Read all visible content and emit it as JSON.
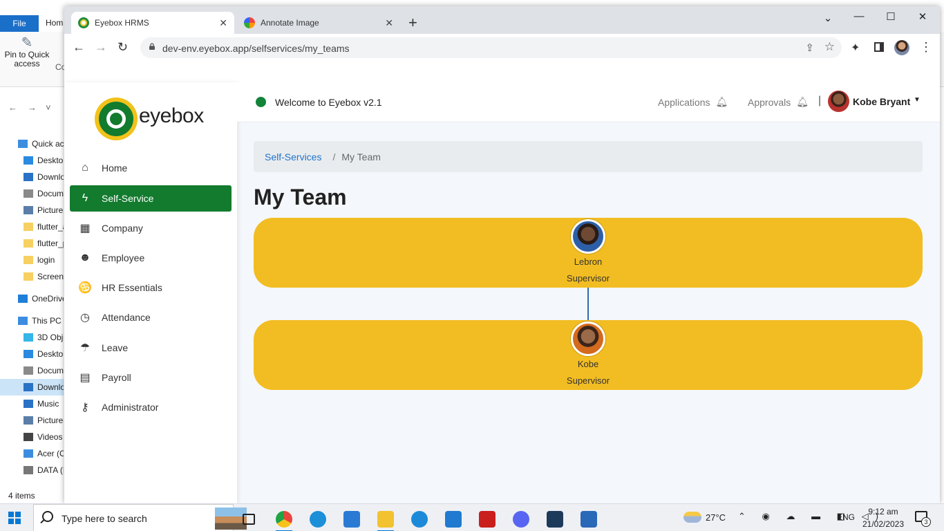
{
  "explorer": {
    "file_tab": "File",
    "home_tab": "Hom",
    "pin_label": "Pin to Quick access",
    "copy_label": "Co",
    "nav_back": "←",
    "nav_forward": "→",
    "nav_dropdown": "˅",
    "tree": [
      {
        "label": "Quick acc",
        "icon": "star-icon",
        "color": "#3c8de0",
        "indent": 1
      },
      {
        "label": "Desktop",
        "icon": "desktop-icon",
        "color": "#2a8ae0",
        "indent": 2
      },
      {
        "label": "Downlo",
        "icon": "download-icon",
        "color": "#2a72c6",
        "indent": 2
      },
      {
        "label": "Docum",
        "icon": "document-icon",
        "color": "#8a8a8a",
        "indent": 2
      },
      {
        "label": "Pictures",
        "icon": "pictures-icon",
        "color": "#5a7ea8",
        "indent": 2
      },
      {
        "label": "flutter_a",
        "icon": "folder-icon",
        "color": "#f7d062",
        "indent": 2
      },
      {
        "label": "flutter_p",
        "icon": "folder-icon",
        "color": "#f7d062",
        "indent": 2
      },
      {
        "label": "login",
        "icon": "folder-icon",
        "color": "#f7d062",
        "indent": 2
      },
      {
        "label": "Screens",
        "icon": "folder-icon",
        "color": "#f7d062",
        "indent": 2
      },
      {
        "label": "OneDrive",
        "icon": "cloud-icon",
        "color": "#1f7fd8",
        "indent": 1
      },
      {
        "label": "This PC",
        "icon": "pc-icon",
        "color": "#3c8de0",
        "indent": 1
      },
      {
        "label": "3D Obje",
        "icon": "cube-icon",
        "color": "#35b6e8",
        "indent": 2
      },
      {
        "label": "Desktop",
        "icon": "desktop-icon",
        "color": "#2a8ae0",
        "indent": 2
      },
      {
        "label": "Docum",
        "icon": "document-icon",
        "color": "#8a8a8a",
        "indent": 2
      },
      {
        "label": "Downlo",
        "icon": "download-icon",
        "color": "#2a72c6",
        "indent": 2,
        "selected": true
      },
      {
        "label": "Music",
        "icon": "music-icon",
        "color": "#2a72c6",
        "indent": 2
      },
      {
        "label": "Pictures",
        "icon": "pictures-icon",
        "color": "#5a7ea8",
        "indent": 2
      },
      {
        "label": "Videos",
        "icon": "video-icon",
        "color": "#444444",
        "indent": 2
      },
      {
        "label": "Acer (C",
        "icon": "drive-icon",
        "color": "#3c8de0",
        "indent": 2
      },
      {
        "label": "DATA (D",
        "icon": "drive-icon",
        "color": "#777777",
        "indent": 2
      }
    ],
    "status": "4 items"
  },
  "browser": {
    "tabs": [
      {
        "title": "Eyebox HRMS",
        "close": "✕"
      },
      {
        "title": "Annotate Image",
        "close": "✕"
      }
    ],
    "new_tab": "+",
    "window_controls": {
      "dropdown": "⌄",
      "minimize": "—",
      "maximize": "☐",
      "close": "✕"
    },
    "url": "dev-env.eyebox.app/selfservices/my_teams",
    "nav": {
      "back": "←",
      "forward": "→",
      "reload": "↻",
      "share": "⇪",
      "star": "☆",
      "extensions": "✦",
      "menu": "⋮"
    }
  },
  "app": {
    "logo_text": "eyebox",
    "sidebar": [
      {
        "label": "Home",
        "icon": "home-icon",
        "glyph": "⌂"
      },
      {
        "label": "Self-Service",
        "icon": "bolt-icon",
        "glyph": "ϟ",
        "active": true
      },
      {
        "label": "Company",
        "icon": "building-icon",
        "glyph": "▦"
      },
      {
        "label": "Employee",
        "icon": "person-icon",
        "glyph": "☻"
      },
      {
        "label": "HR Essentials",
        "icon": "handshake-icon",
        "glyph": "♋"
      },
      {
        "label": "Attendance",
        "icon": "clock-icon",
        "glyph": "◷"
      },
      {
        "label": "Leave",
        "icon": "umbrella-beach-icon",
        "glyph": "☂"
      },
      {
        "label": "Payroll",
        "icon": "calculator-icon",
        "glyph": "▤"
      },
      {
        "label": "Administrator",
        "icon": "key-icon",
        "glyph": "⚷"
      }
    ],
    "topbar": {
      "welcome": "Welcome to Eyebox v2.1",
      "applications": "Applications",
      "approvals": "Approvals",
      "divider": "|",
      "user_name": "Kobe Bryant",
      "caret": "▼",
      "bell": "🔔︎"
    },
    "breadcrumb": {
      "parent": "Self-Services",
      "separator": "/",
      "current": "My Team"
    },
    "page_title": "My Team",
    "team": [
      {
        "name": "Lebron",
        "role": "Supervisor"
      },
      {
        "name": "Kobe",
        "role": "Supervisor"
      }
    ],
    "colors": {
      "primary_green": "#127b2e",
      "card_yellow": "#f2bd22",
      "link_blue": "#1f74c9",
      "connector": "#2c6bb3"
    }
  },
  "taskbar": {
    "search_placeholder": "Type here to search",
    "apps": [
      {
        "name": "task-view-icon",
        "color": "#222222"
      },
      {
        "name": "chrome-icon",
        "color": "#e8453c",
        "running": true
      },
      {
        "name": "edge-icon",
        "color": "#1b8fd8"
      },
      {
        "name": "mail-icon",
        "color": "#2a7ad4"
      },
      {
        "name": "file-explorer-icon",
        "color": "#f2c230",
        "running": true
      },
      {
        "name": "openvpn-icon",
        "color": "#1c8ad8"
      },
      {
        "name": "vscode-icon",
        "color": "#1f7ad0"
      },
      {
        "name": "filezilla-icon",
        "color": "#c9201d"
      },
      {
        "name": "discord-icon",
        "color": "#5865f2"
      },
      {
        "name": "terminal-app-icon",
        "color": "#1e3a5a"
      },
      {
        "name": "photos-icon",
        "color": "#2a68b8"
      }
    ],
    "temperature": "27°C",
    "tray_glyphs": "⌃ ◉ ☁ ▬ ◧ ◁)",
    "language": "ENG",
    "time": "9:12 am",
    "date": "21/02/2023",
    "notification_count": "3"
  }
}
